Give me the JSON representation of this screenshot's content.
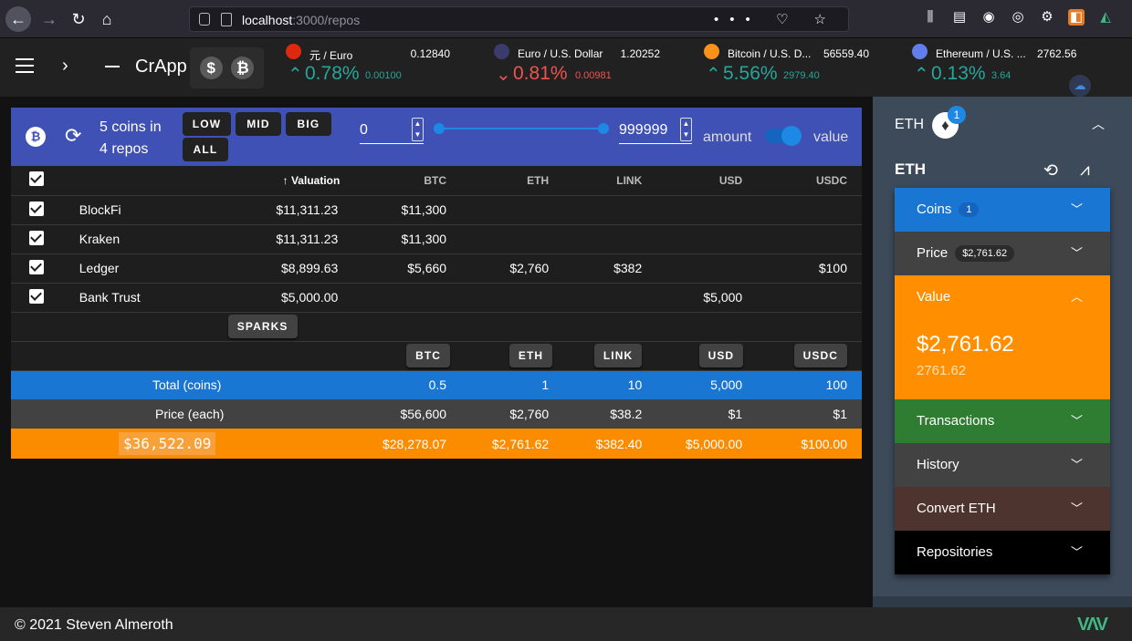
{
  "browser": {
    "url_host": "localhost",
    "url_path": ":3000/repos",
    "page_actions": "••• ♡ ☆",
    "toolbar_icons": [
      "library-icon",
      "reader-icon",
      "account-icon",
      "extension-glasses-icon",
      "gear-icon",
      "extension-orange-icon",
      "extension-vue-icon"
    ]
  },
  "appbar": {
    "title": "CrApp",
    "toggle_usd": "$",
    "toggle_btc": "₿",
    "tickers": [
      {
        "name": "元 / Euro",
        "price": "0.12840",
        "pct": "0.78%",
        "delta": "0.00100",
        "dir": "up",
        "flag": "#de2910"
      },
      {
        "name": "Euro / U.S. Dollar",
        "price": "1.20252",
        "pct": "0.81%",
        "delta": "0.00981",
        "dir": "down",
        "flag": "#3c3b6e"
      },
      {
        "name": "Bitcoin / U.S. D...",
        "price": "56559.40",
        "pct": "5.56%",
        "delta": "2979.40",
        "dir": "up",
        "flag": "#f7931a"
      },
      {
        "name": "Ethereum / U.S. ...",
        "price": "2762.56",
        "pct": "0.13%",
        "delta": "3.64",
        "dir": "up",
        "flag": "#627eea"
      }
    ]
  },
  "toolbar": {
    "coins_line1": "5 coins in",
    "coins_line2": "4 repos",
    "chips": [
      "LOW",
      "MID",
      "BIG",
      "ALL"
    ],
    "min": "0",
    "max": "999999",
    "amount_label": "amount",
    "value_label": "value"
  },
  "table": {
    "headers": [
      "Valuation",
      "BTC",
      "ETH",
      "LINK",
      "USD",
      "USDC"
    ],
    "rows": [
      {
        "name": "BlockFi",
        "valuation": "$11,311.23",
        "btc": "$11,300",
        "eth": "",
        "link": "",
        "usd": "",
        "usdc": ""
      },
      {
        "name": "Kraken",
        "valuation": "$11,311.23",
        "btc": "$11,300",
        "eth": "",
        "link": "",
        "usd": "",
        "usdc": ""
      },
      {
        "name": "Ledger",
        "valuation": "$8,899.63",
        "btc": "$5,660",
        "eth": "$2,760",
        "link": "$382",
        "usd": "",
        "usdc": "$100"
      },
      {
        "name": "Bank Trust",
        "valuation": "$5,000.00",
        "btc": "",
        "eth": "",
        "link": "",
        "usd": "$5,000",
        "usdc": ""
      }
    ],
    "sparks": "SPARKS",
    "coin_buttons": [
      "BTC",
      "ETH",
      "LINK",
      "USD",
      "USDC"
    ],
    "total": {
      "label": "Total (coins)",
      "values": [
        "0.5",
        "1",
        "10",
        "5,000",
        "100"
      ]
    },
    "price": {
      "label": "Price (each)",
      "values": [
        "$56,600",
        "$2,760",
        "$38.2",
        "$1",
        "$1"
      ]
    },
    "value": {
      "grand": "$36,522.09",
      "values": [
        "$28,278.07",
        "$2,761.62",
        "$382.40",
        "$5,000.00",
        "$100.00"
      ]
    }
  },
  "panel": {
    "head": "ETH",
    "badge_count": "1",
    "title": "ETH",
    "coins_label": "Coins",
    "coins_count": "1",
    "price_label": "Price",
    "price_value": "$2,761.62",
    "value_label": "Value",
    "value_big": "$2,761.62",
    "value_small": "2761.62",
    "transactions": "Transactions",
    "history": "History",
    "convert": "Convert ETH",
    "repositories": "Repositories"
  },
  "footer": {
    "copyright": "© 2021 Steven Almeroth"
  },
  "colors": {
    "indigo": "#3f51b5",
    "blue": "#1976d2",
    "orange": "#fb8c00",
    "up": "#26a69a",
    "down": "#ef5350"
  }
}
